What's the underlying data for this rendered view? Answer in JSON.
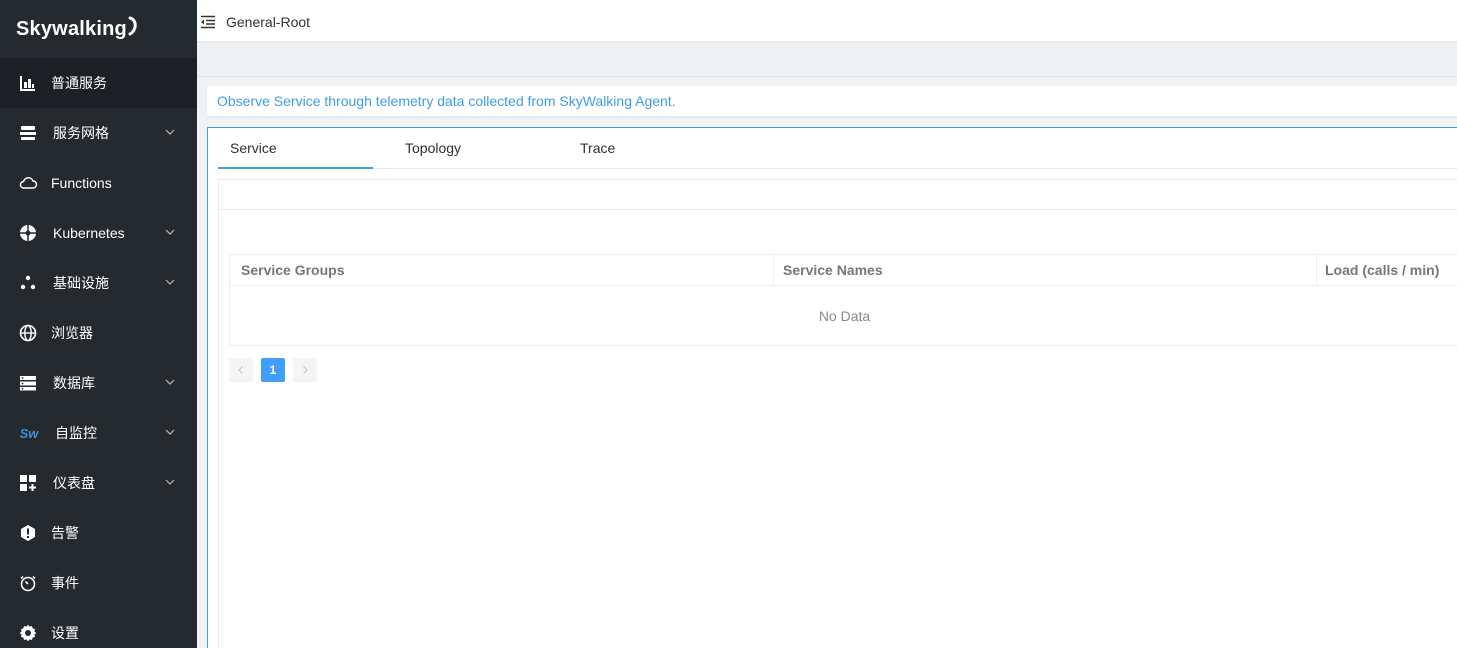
{
  "app": {
    "logo_text": "Skywalking"
  },
  "sidebar": {
    "items": [
      {
        "label": "普通服务",
        "icon": "bar-chart-icon",
        "active": true,
        "has_submenu": false
      },
      {
        "label": "服务网格",
        "icon": "server-stack-icon",
        "active": false,
        "has_submenu": true
      },
      {
        "label": "Functions",
        "icon": "cloud-icon",
        "active": false,
        "has_submenu": false
      },
      {
        "label": "Kubernetes",
        "icon": "kubernetes-icon",
        "active": false,
        "has_submenu": true
      },
      {
        "label": "基础设施",
        "icon": "dots-cluster-icon",
        "active": false,
        "has_submenu": true
      },
      {
        "label": "浏览器",
        "icon": "globe-icon",
        "active": false,
        "has_submenu": false
      },
      {
        "label": "数据库",
        "icon": "database-icon",
        "active": false,
        "has_submenu": true
      },
      {
        "label": "自监控",
        "icon": "sw-logo-icon",
        "icon_text": "Sw",
        "active": false,
        "has_submenu": true
      },
      {
        "label": "仪表盘",
        "icon": "dashboard-add-icon",
        "active": false,
        "has_submenu": true
      },
      {
        "label": "告警",
        "icon": "alert-hexagon-icon",
        "active": false,
        "has_submenu": false
      },
      {
        "label": "事件",
        "icon": "timer-icon",
        "active": false,
        "has_submenu": false
      },
      {
        "label": "设置",
        "icon": "gear-icon",
        "active": false,
        "has_submenu": false
      }
    ]
  },
  "header": {
    "breadcrumb": "General-Root"
  },
  "description": "Observe Service through telemetry data collected from SkyWalking Agent.",
  "tabs": [
    {
      "label": "Service",
      "active": true
    },
    {
      "label": "Topology",
      "active": false
    },
    {
      "label": "Trace",
      "active": false
    }
  ],
  "table": {
    "columns": [
      "Service Groups",
      "Service Names",
      "Load (calls / min)"
    ],
    "empty_text": "No Data"
  },
  "pagination": {
    "current_page": "1",
    "prev_icon": "chevron-left-icon",
    "next_icon": "chevron-right-icon"
  },
  "colors": {
    "sidebar_bg": "#252a2f",
    "accent": "#3f9ce8",
    "pager_active": "#409eff"
  }
}
